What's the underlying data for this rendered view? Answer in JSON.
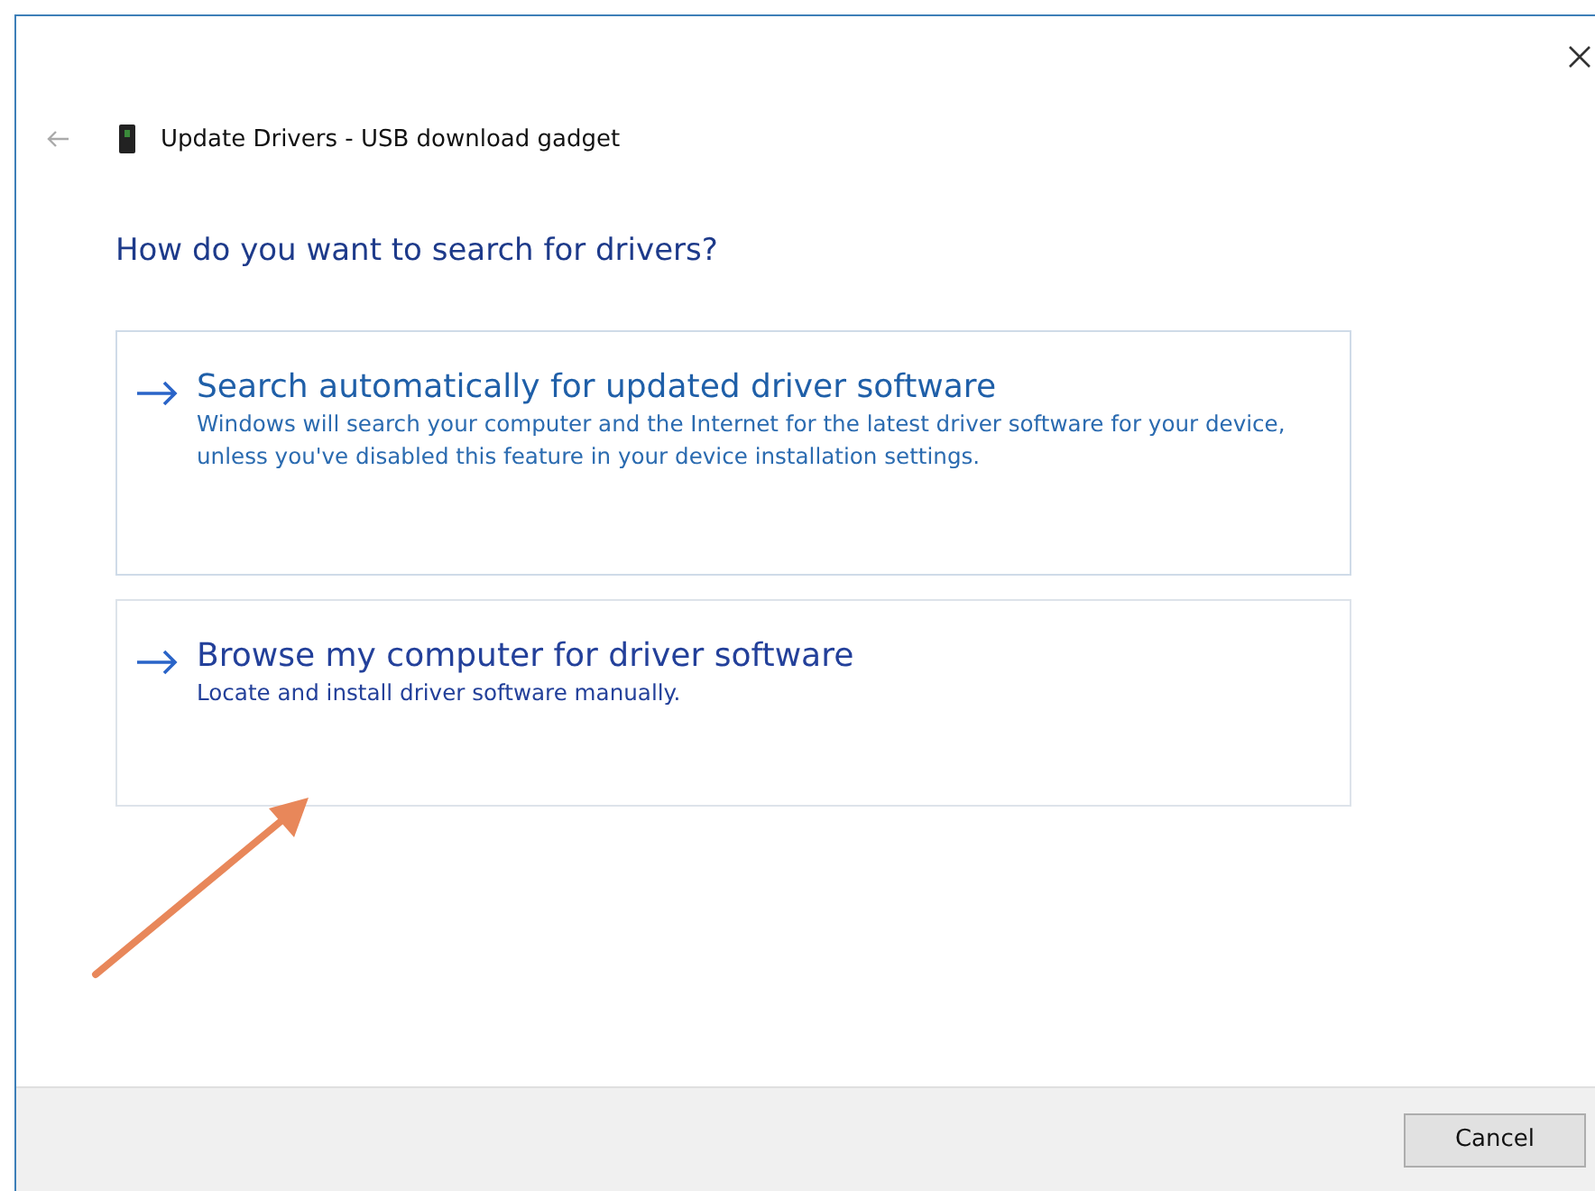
{
  "window": {
    "title": "Update Drivers - USB download gadget"
  },
  "heading": "How do you want to search for drivers?",
  "options": [
    {
      "title": "Search automatically for updated driver software",
      "description": "Windows will search your computer and the Internet for the latest driver software for your device, unless you've disabled this feature in your device installation settings."
    },
    {
      "title": "Browse my computer for driver software",
      "description": "Locate and install driver software manually."
    }
  ],
  "buttons": [
    "Cancel"
  ]
}
